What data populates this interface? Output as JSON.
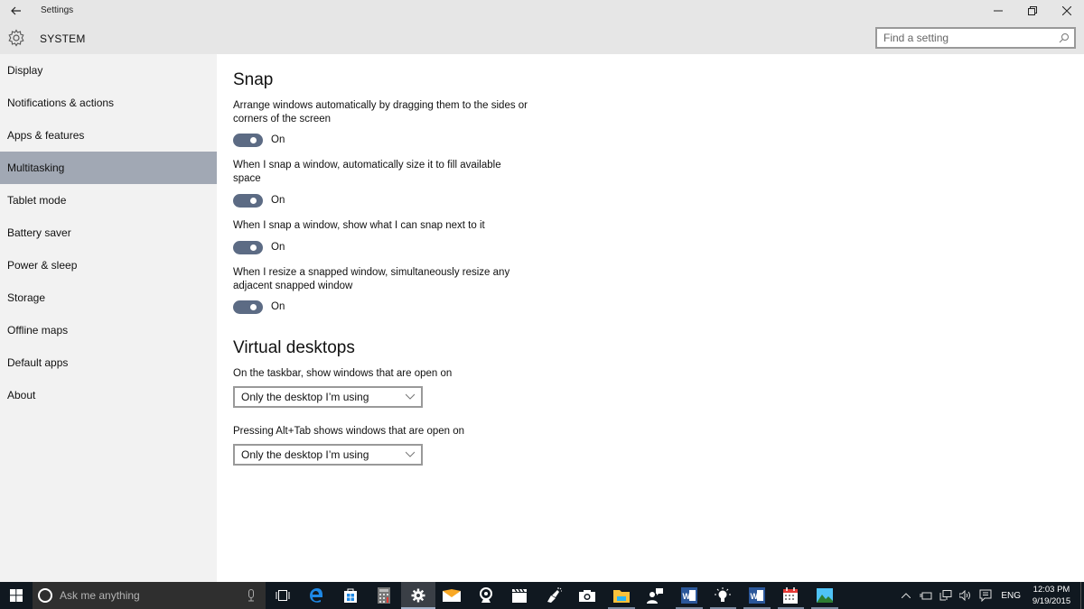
{
  "window": {
    "app_title": "Settings",
    "section_title": "SYSTEM",
    "controls": {
      "minimize": "minimize-icon",
      "restore": "restore-icon",
      "close": "close-icon"
    }
  },
  "search": {
    "placeholder": "Find a setting",
    "value": ""
  },
  "sidebar": {
    "items": [
      {
        "label": "Display",
        "active": false
      },
      {
        "label": "Notifications & actions",
        "active": false
      },
      {
        "label": "Apps & features",
        "active": false
      },
      {
        "label": "Multitasking",
        "active": true
      },
      {
        "label": "Tablet mode",
        "active": false
      },
      {
        "label": "Battery saver",
        "active": false
      },
      {
        "label": "Power & sleep",
        "active": false
      },
      {
        "label": "Storage",
        "active": false
      },
      {
        "label": "Offline maps",
        "active": false
      },
      {
        "label": "Default apps",
        "active": false
      },
      {
        "label": "About",
        "active": false
      }
    ]
  },
  "snap": {
    "heading": "Snap",
    "settings": [
      {
        "label": "Arrange windows automatically by dragging them to the sides or corners of the screen",
        "state": "On",
        "on": true
      },
      {
        "label": "When I snap a window, automatically size it to fill available space",
        "state": "On",
        "on": true
      },
      {
        "label": "When I snap a window, show what I can snap next to it",
        "state": "On",
        "on": true
      },
      {
        "label": "When I resize a snapped window, simultaneously resize any adjacent snapped window",
        "state": "On",
        "on": true
      }
    ]
  },
  "virtual_desktops": {
    "heading": "Virtual desktops",
    "settings": [
      {
        "label": "On the taskbar, show windows that are open on",
        "selected": "Only the desktop I’m using"
      },
      {
        "label": "Pressing Alt+Tab shows windows that are open on",
        "selected": "Only the desktop I’m using"
      }
    ]
  },
  "taskbar": {
    "cortana_placeholder": "Ask me anything",
    "apps": [
      "task-view",
      "edge",
      "store",
      "calculator",
      "settings",
      "mail",
      "webcam",
      "movies",
      "paint",
      "camera",
      "file-explorer",
      "people",
      "word",
      "tips",
      "word-2",
      "calendar",
      "photos"
    ],
    "active_app": "settings",
    "tray": {
      "language": "ENG",
      "time": "12:03 PM",
      "date": "9/19/2015"
    }
  },
  "colors": {
    "accent_toggle": "#5c6b84",
    "sidebar_active": "#a1a8b4",
    "sidebar_bg": "#f2f2f2",
    "titlebar_bg": "#e6e6e6",
    "taskbar_bg": "#101820"
  }
}
